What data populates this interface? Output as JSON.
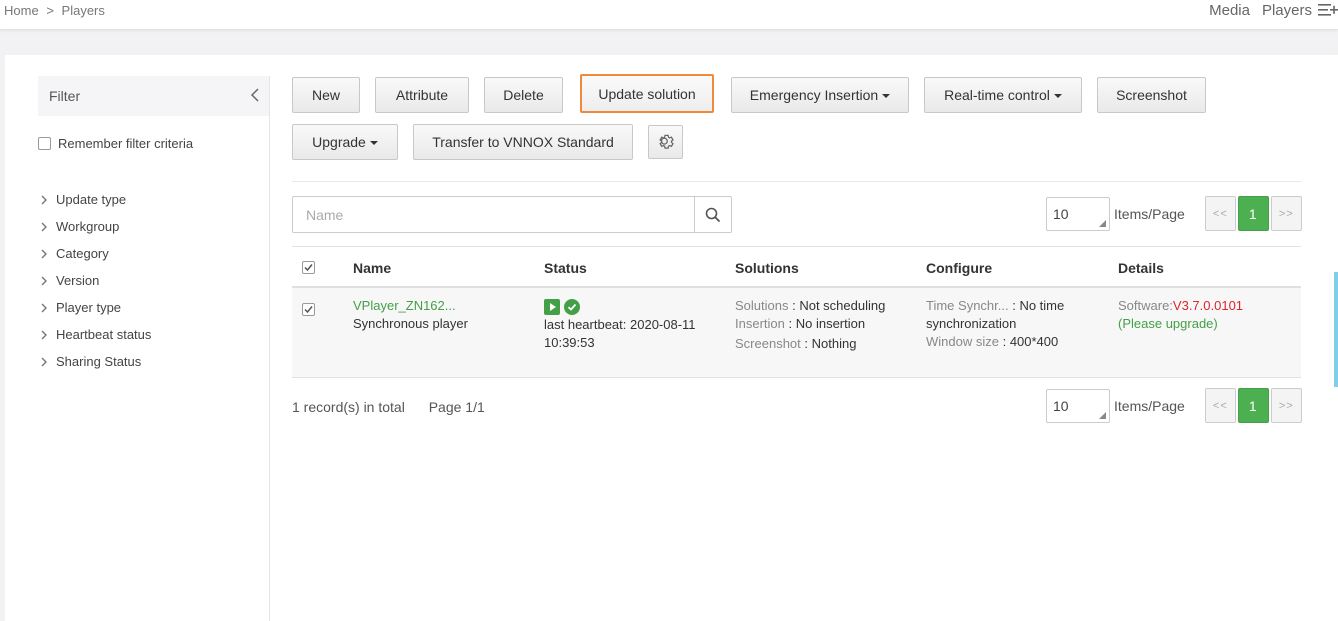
{
  "breadcrumb": {
    "home": "Home",
    "sep": ">",
    "current": "Players"
  },
  "topnav": {
    "media": "Media",
    "players": "Players",
    "menu_icon": "menu-add-icon"
  },
  "filter": {
    "title": "Filter",
    "remember_label": "Remember filter criteria",
    "items": [
      {
        "label": "Update type"
      },
      {
        "label": "Workgroup"
      },
      {
        "label": "Category"
      },
      {
        "label": "Version"
      },
      {
        "label": "Player type"
      },
      {
        "label": "Heartbeat status"
      },
      {
        "label": "Sharing Status"
      }
    ]
  },
  "toolbar": {
    "new": "New",
    "attribute": "Attribute",
    "delete": "Delete",
    "update_solution": "Update solution",
    "emergency_insertion": "Emergency Insertion",
    "realtime_control": "Real-time control",
    "screenshot": "Screenshot",
    "upgrade": "Upgrade",
    "transfer": "Transfer to VNNOX Standard",
    "settings_icon": "gear-icon"
  },
  "search": {
    "placeholder": "Name"
  },
  "pagination": {
    "page_size": "10",
    "items_per_page_label": "Items/Page",
    "prev": "<<",
    "current": "1",
    "next": ">>"
  },
  "table": {
    "headers": {
      "name": "Name",
      "status": "Status",
      "solutions": "Solutions",
      "configure": "Configure",
      "details": "Details"
    },
    "row": {
      "name": "VPlayer_ZN162...",
      "type": "Synchronous player",
      "heartbeat": "last heartbeat: 2020-08-11 10:39:53",
      "solutions_label": "Solutions",
      "solutions_value": "Not scheduling",
      "insertion_label": "Insertion",
      "insertion_value": "No insertion",
      "screenshot_label": "Screenshot",
      "screenshot_value": "Nothing",
      "time_sync_label": "Time Synchr...",
      "time_sync_value": "No time synchronization",
      "window_size_label": "Window size",
      "window_size_value": "400*400",
      "software_label": "Software:",
      "software_value": "V3.7.0.0101",
      "upgrade_hint": "(Please upgrade)"
    }
  },
  "footer": {
    "total": "1 record(s) in total",
    "page": "Page 1/1"
  },
  "colors": {
    "accent_orange": "#ef8a3c",
    "green": "#43a047",
    "red": "#d9262f"
  }
}
